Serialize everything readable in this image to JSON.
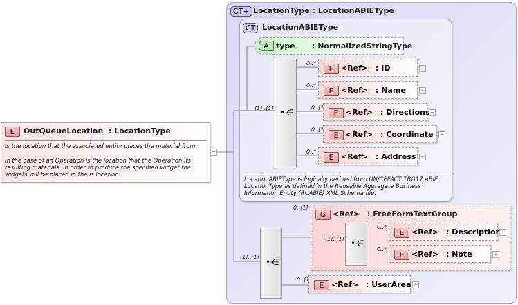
{
  "root": {
    "badge": "E",
    "name": "OutQueueLocation",
    "type": ": LocationType",
    "doc": [
      "Is the location that the associated entity places the material from.",
      "In the case of an Operation is the location that the Operation its resulting materials. In order to produce the specified widget the widgets will be placed in the is location."
    ],
    "toggle": "−"
  },
  "complex_type": {
    "badge": "CT+",
    "title": "LocationType : LocationABIEType"
  },
  "base_type": {
    "badge": "CT",
    "title": "LocationABIEType",
    "doc": "LocationABIEType is logically derived from UN/CEFACT TBG17 ABIE LocationType as defined in the Reusable Aggregate Business Information Entity (RUABIE) XML Schema file."
  },
  "attribute": {
    "badge": "A",
    "name": "type",
    "type": ": NormalizedStringType"
  },
  "sequence1": {
    "cardinality": "[1]..[1]",
    "elements": [
      {
        "badge": "E",
        "ref": "<Ref>",
        "name": ": ID",
        "card": "0..*"
      },
      {
        "badge": "E",
        "ref": "<Ref>",
        "name": ": Name",
        "card": "0..*"
      },
      {
        "badge": "E",
        "ref": "<Ref>",
        "name": ": Directions",
        "card": "0..[1]"
      },
      {
        "badge": "E",
        "ref": "<Ref>",
        "name": ": Coordinate",
        "card": "0..[1]"
      },
      {
        "badge": "E",
        "ref": "<Ref>",
        "name": ": Address",
        "card": "0..*"
      }
    ]
  },
  "sequence2": {
    "cardinality": "[1]..[1]",
    "group": {
      "badge": "G",
      "ref": "<Ref>",
      "name": ": FreeFormTextGroup",
      "card": "0..[1]",
      "seq_card": "[1]..[1]",
      "elements": [
        {
          "badge": "E",
          "ref": "<Ref>",
          "name": ": Description",
          "card": "0..*"
        },
        {
          "badge": "E",
          "ref": "<Ref>",
          "name": ": Note",
          "card": "0..*"
        }
      ]
    },
    "user_area": {
      "badge": "E",
      "ref": "<Ref>",
      "name": ": UserArea",
      "card": "0..[1]"
    }
  },
  "plus": "+"
}
